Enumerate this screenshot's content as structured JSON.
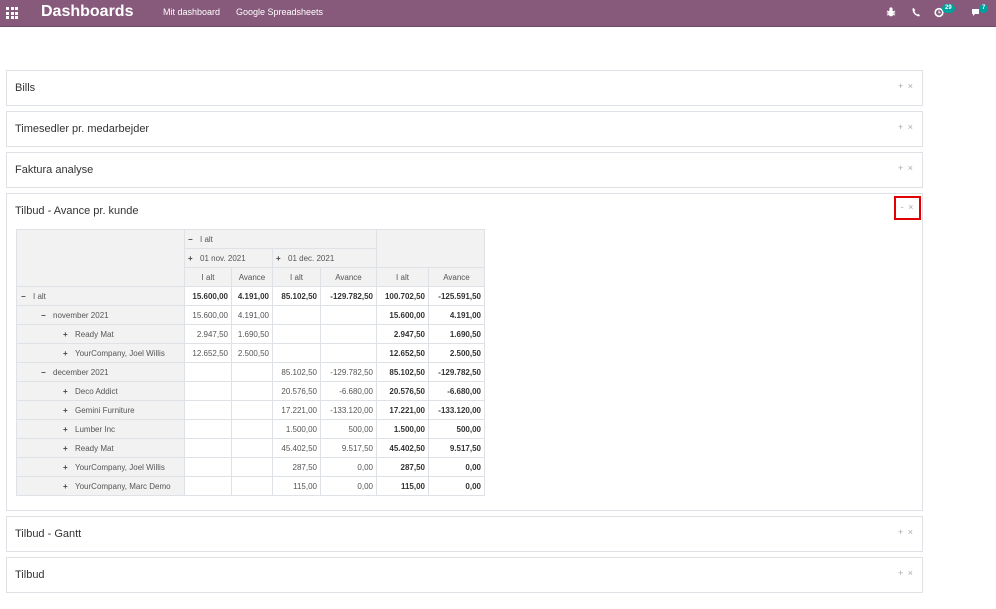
{
  "topbar": {
    "app_title": "Dashboards",
    "menu": [
      "Mit dashboard",
      "Google Spreadsheets"
    ],
    "icons": [
      "bug-icon",
      "phone-icon",
      "activity-icon",
      "chat-icon"
    ],
    "activity_count": "29",
    "message_count": "7"
  },
  "dashboards": {
    "bills": "Bills",
    "timesheets": "Timesedler pr. medarbejder",
    "invoice": "Faktura analyse",
    "quotes_margin": "Tilbud - Avance pr. kunde",
    "quotes_gantt": "Tilbud - Gantt",
    "quotes": "Tilbud",
    "action_add": "+",
    "action_remove": "×",
    "action_fold": "-"
  },
  "pivot": {
    "header_total": "I alt",
    "col_nov": "01 nov. 2021",
    "col_dec": "01 dec. 2021",
    "measures": [
      "I alt",
      "Avance",
      "I alt",
      "Avance",
      "I alt",
      "Avance"
    ],
    "rows": [
      {
        "label": "I alt",
        "level": 0,
        "sign": "−",
        "values": [
          "15.600,00",
          "4.191,00",
          "85.102,50",
          "-129.782,50",
          "100.702,50",
          "-125.591,50"
        ]
      },
      {
        "label": "november 2021",
        "level": 1,
        "sign": "−",
        "values": [
          "15.600,00",
          "4.191,00",
          "",
          "",
          "15.600,00",
          "4.191,00"
        ]
      },
      {
        "label": "Ready Mat",
        "level": 2,
        "sign": "+",
        "values": [
          "2.947,50",
          "1.690,50",
          "",
          "",
          "2.947,50",
          "1.690,50"
        ]
      },
      {
        "label": "YourCompany, Joel Willis",
        "level": 2,
        "sign": "+",
        "values": [
          "12.652,50",
          "2.500,50",
          "",
          "",
          "12.652,50",
          "2.500,50"
        ]
      },
      {
        "label": "december 2021",
        "level": 1,
        "sign": "−",
        "values": [
          "",
          "",
          "85.102,50",
          "-129.782,50",
          "85.102,50",
          "-129.782,50"
        ]
      },
      {
        "label": "Deco Addict",
        "level": 2,
        "sign": "+",
        "values": [
          "",
          "",
          "20.576,50",
          "-6.680,00",
          "20.576,50",
          "-6.680,00"
        ]
      },
      {
        "label": "Gemini Furniture",
        "level": 2,
        "sign": "+",
        "values": [
          "",
          "",
          "17.221,00",
          "-133.120,00",
          "17.221,00",
          "-133.120,00"
        ]
      },
      {
        "label": "Lumber Inc",
        "level": 2,
        "sign": "+",
        "values": [
          "",
          "",
          "1.500,00",
          "500,00",
          "1.500,00",
          "500,00"
        ]
      },
      {
        "label": "Ready Mat",
        "level": 2,
        "sign": "+",
        "values": [
          "",
          "",
          "45.402,50",
          "9.517,50",
          "45.402,50",
          "9.517,50"
        ]
      },
      {
        "label": "YourCompany, Joel Willis",
        "level": 2,
        "sign": "+",
        "values": [
          "",
          "",
          "287,50",
          "0,00",
          "287,50",
          "0,00"
        ]
      },
      {
        "label": "YourCompany, Marc Demo",
        "level": 2,
        "sign": "+",
        "values": [
          "",
          "",
          "115,00",
          "0,00",
          "115,00",
          "0,00"
        ]
      }
    ]
  }
}
